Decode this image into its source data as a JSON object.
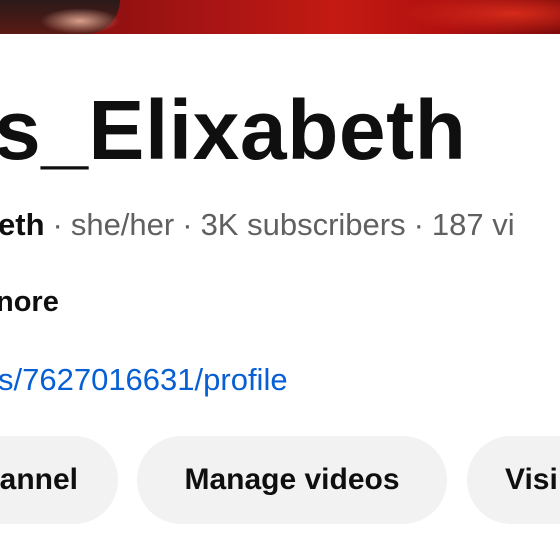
{
  "channel": {
    "name": "s_Elixabeth",
    "handle": "eth",
    "pronouns": "she/her",
    "subscribers": "3K subscribers",
    "videos_partial": "187 vi",
    "separator": "·",
    "more_label": "nore",
    "link": "s/7627016631/profile"
  },
  "actions": {
    "channel_label": "annel",
    "manage_label": "Manage videos",
    "visit_label": "Visi"
  },
  "colors": {
    "link": "#065fd4",
    "button_bg": "#f2f2f2",
    "text_primary": "#0f0f0f",
    "text_secondary": "#606060"
  }
}
